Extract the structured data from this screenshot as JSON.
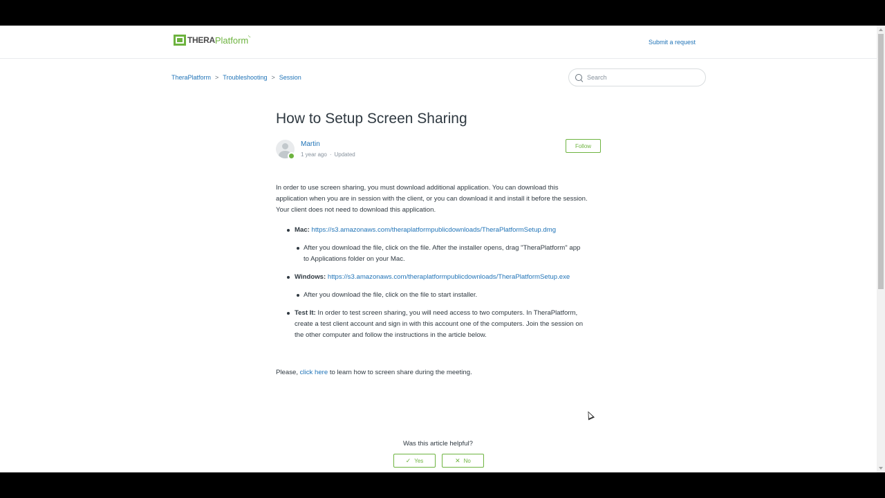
{
  "header": {
    "logo_thera": "THERA",
    "logo_platform": "Platform",
    "submit_request": "Submit a request"
  },
  "breadcrumbs": [
    "TheraPlatform",
    "Troubleshooting",
    "Session"
  ],
  "breadcrumb_separator": ">",
  "search": {
    "placeholder": "Search",
    "icon": "search-icon"
  },
  "article": {
    "title": "How to Setup Screen Sharing",
    "author": "Martin",
    "time": "1 year ago",
    "updated": "Updated",
    "follow": "Follow",
    "intro_line1": "In order to use screen sharing, you must download additional application. You can download this",
    "intro_line2": "application when you are in session with the client, or you can download it and install it before the session.",
    "intro_line3": "Your client does not need to download this application.",
    "mac_label": "Mac:",
    "mac_link": "https://s3.amazonaws.com/theraplatformpublicdownloads/TheraPlatformSetup.dmg",
    "mac_note_line1": "After you download the file, click on the file. After the installer opens, drag \"TheraPlatform\" app",
    "mac_note_line2": "to Applications folder on your Mac.",
    "windows_label": "Windows:",
    "windows_link": "https://s3.amazonaws.com/theraplatformpublicdownloads/TheraPlatformSetup.exe",
    "windows_note": "After you download the file, click on the file to start installer.",
    "test_label": "Test It:",
    "test_line1": "In order to test screen sharing, you will need access to two computers. In TheraPlatform,",
    "test_line2": "create a test client account and sign in with this account one of the computers. Join the session on",
    "test_line3": "the other computer and follow the instructions in the article below.",
    "closing_prefix": "Please,",
    "closing_link": "click here",
    "closing_suffix": "to learn how to screen share during the meeting.",
    "helpful_question": "Was this article helpful?",
    "yes": "Yes",
    "no": "No",
    "yes_icon": "✓",
    "no_icon": "✕"
  },
  "colors": {
    "brand_green": "#6db33f",
    "link_blue": "#1f73b7",
    "text": "#2f3941"
  }
}
